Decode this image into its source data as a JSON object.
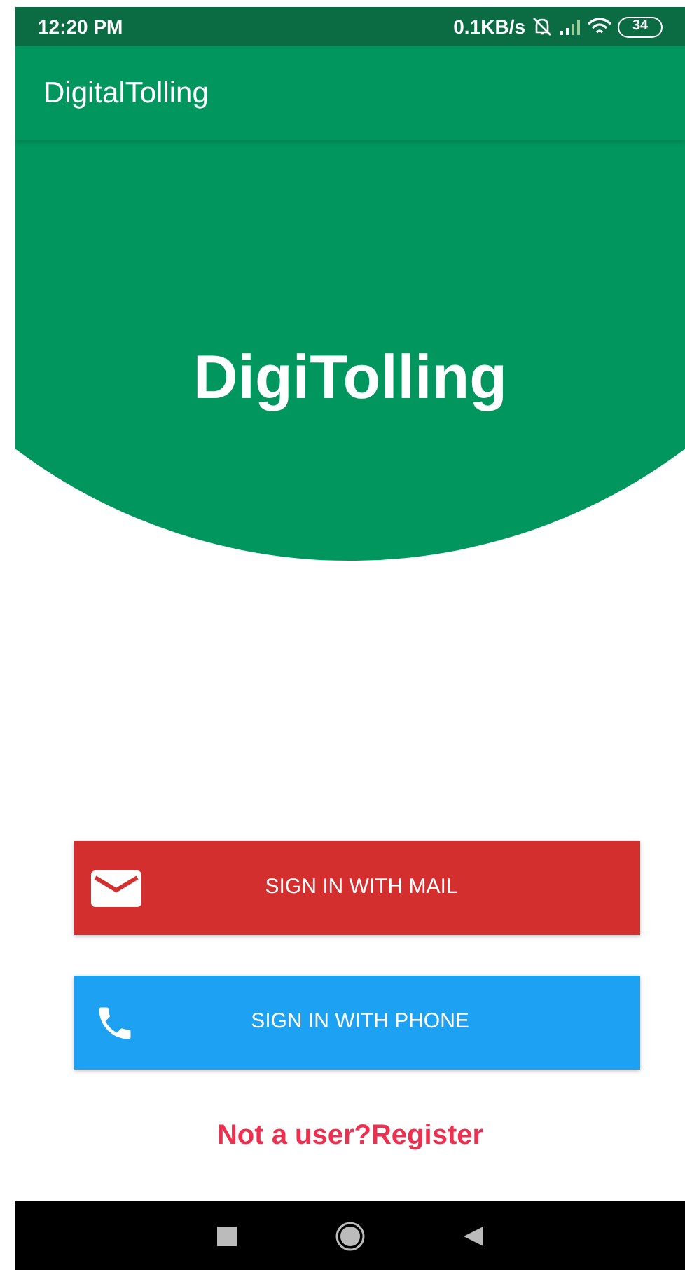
{
  "status_bar": {
    "time": "12:20 PM",
    "speed": "0.1KB/s",
    "battery": "34"
  },
  "app_bar": {
    "title": "DigitalTolling"
  },
  "hero": {
    "title": "DigiTolling"
  },
  "buttons": [
    {
      "kind": "mail",
      "label": "SIGN IN WITH MAIL",
      "color": "#d32f2f"
    },
    {
      "kind": "phone",
      "label": "SIGN IN WITH PHONE",
      "color": "#1da1f2"
    }
  ],
  "register_link": "Not a user?Register"
}
